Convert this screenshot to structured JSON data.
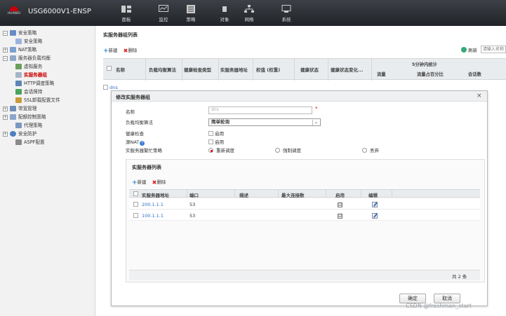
{
  "app": {
    "brand": "HUAWEI",
    "title": "USG6000V1-ENSP"
  },
  "topnav": [
    {
      "label": "面板",
      "icon": "dashboard-icon"
    },
    {
      "label": "监控",
      "icon": "monitor-icon"
    },
    {
      "label": "策略",
      "icon": "policy-icon"
    },
    {
      "label": "对象",
      "icon": "object-icon"
    },
    {
      "label": "网络",
      "icon": "network-icon"
    },
    {
      "label": "系统",
      "icon": "system-icon"
    }
  ],
  "sidebar": {
    "items": [
      {
        "label": "安全策略"
      },
      {
        "label": "安全策略"
      },
      {
        "label": "NAT策略"
      },
      {
        "label": "服务器负载均衡"
      },
      {
        "label": "虚拟服务"
      },
      {
        "label": "实服务器组"
      },
      {
        "label": "HTTP调度策略"
      },
      {
        "label": "会话保持"
      },
      {
        "label": "SSL卸载配置文件"
      },
      {
        "label": "带宽管理"
      },
      {
        "label": "配额控制策略"
      },
      {
        "label": "代理策略"
      },
      {
        "label": "安全防护"
      },
      {
        "label": "ASPF配置"
      }
    ]
  },
  "main": {
    "title": "实服务器组列表",
    "toolbar": {
      "new": "新建",
      "delete": "删除"
    },
    "refresh": "刷新",
    "search_placeholder": "请输入名称",
    "columns": [
      "名称",
      "负载均衡算法",
      "健康检查类型",
      "实服务器地址",
      "权值 (权重)",
      "健康状态",
      "健康状态变化...",
      "5分钟内统计",
      "流量",
      "流量占百分比",
      "会话数"
    ],
    "rows": [
      {
        "name": "dns"
      }
    ]
  },
  "modal": {
    "title": "修改实服务器组",
    "fields": {
      "name_label": "名称",
      "name_value": "dns",
      "algo_label": "负载均衡算法",
      "algo_value": "简单轮询",
      "health_label": "健康检查",
      "health_opt": "启用",
      "snat_label": "源NAT",
      "snat_opt": "启用",
      "busy_label": "实服务器繁忙策略",
      "busy_options": [
        "重新调度",
        "强制调度",
        "丢弃"
      ],
      "busy_selected": "重新调度"
    },
    "sub": {
      "title": "实服务器列表",
      "toolbar": {
        "new": "新建",
        "delete": "删除"
      },
      "columns": [
        "实服务器地址",
        "端口",
        "描述",
        "最大连接数",
        "启用",
        "编辑"
      ],
      "rows": [
        {
          "address": "200.1.1.1",
          "port": "53",
          "desc": "",
          "max_conn": "",
          "enabled": "☑"
        },
        {
          "address": "100.1.1.1",
          "port": "53",
          "desc": "",
          "max_conn": "",
          "enabled": "☑"
        }
      ],
      "total": "共 2 条"
    },
    "buttons": {
      "ok": "确定",
      "cancel": "取消"
    }
  },
  "watermark": "CSDN @freshman_start"
}
